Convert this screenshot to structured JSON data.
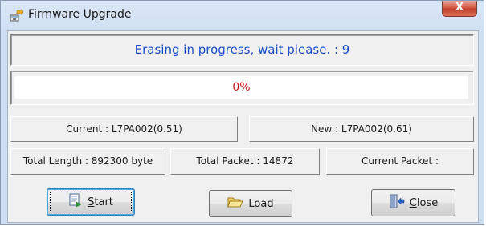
{
  "window": {
    "title": "Firmware Upgrade",
    "close_glyph": "X"
  },
  "status": {
    "message": "Erasing in progress, wait please.  : 9",
    "color": "#1a4fc9"
  },
  "progress": {
    "label": "0%",
    "value": 0,
    "text_color": "#c0151a"
  },
  "version": {
    "current": "Current : L7PA002(0.51)",
    "new": "New : L7PA002(0.61)"
  },
  "stats": {
    "total_length": "Total Length : 892300 byte",
    "total_packet": "Total Packet : 14872",
    "current_packet": "Current Packet :"
  },
  "buttons": {
    "start": {
      "mnemonic": "S",
      "rest": "tart",
      "icon": "start-icon"
    },
    "load": {
      "mnemonic": "L",
      "rest": "oad",
      "icon": "folder-open-icon"
    },
    "close": {
      "mnemonic": "C",
      "rest": "lose",
      "icon": "exit-door-icon"
    }
  }
}
